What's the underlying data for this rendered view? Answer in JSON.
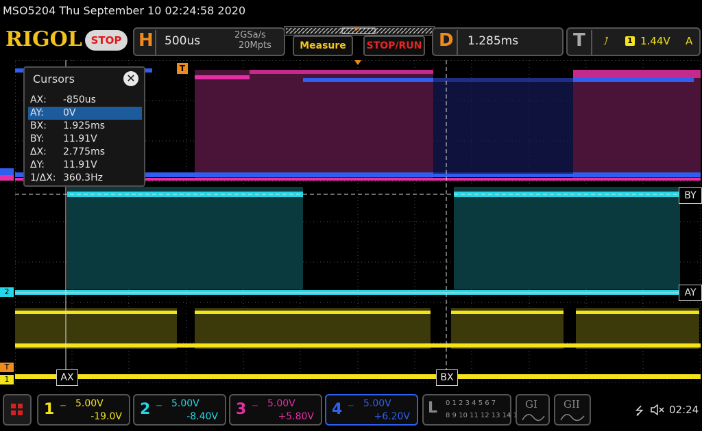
{
  "title": "MSO5204  Thu September 10 02:24:58 2020",
  "brand": "RIGOL",
  "run_state": "STOP",
  "horizontal": {
    "letter": "H",
    "timebase": "500us",
    "sample_rate": "2GSa/s",
    "memory_depth": "20Mpts"
  },
  "buttons": {
    "measure": "Measure",
    "stop_run": "STOP/RUN"
  },
  "delay": {
    "letter": "D",
    "value": "1.285ms"
  },
  "trigger": {
    "letter": "T",
    "source": "1",
    "level": "1.44V",
    "mode": "A"
  },
  "cursors": {
    "title": "Cursors",
    "close": "✕",
    "rows": [
      {
        "key": "AX:",
        "value": "-850us"
      },
      {
        "key": "AY:",
        "value": "0V"
      },
      {
        "key": "BX:",
        "value": "1.925ms"
      },
      {
        "key": "BY:",
        "value": "11.91V"
      },
      {
        "key": "ΔX:",
        "value": "2.775ms"
      },
      {
        "key": "ΔY:",
        "value": "11.91V"
      },
      {
        "key": "1/ΔX:",
        "value": "360.3Hz"
      }
    ],
    "selected_index": 1
  },
  "cursor_tags": {
    "ax": "AX",
    "bx": "BX",
    "ay": "AY",
    "by": "BY"
  },
  "edge_markers": {
    "ch1": "1",
    "ch2": "2",
    "trig": "T"
  },
  "channels": [
    {
      "num": "1",
      "scale": "5.00V",
      "offset": "-19.0V",
      "color": "#f5e31a"
    },
    {
      "num": "2",
      "scale": "5.00V",
      "offset": "-8.40V",
      "color": "#23d7e6"
    },
    {
      "num": "3",
      "scale": "5.00V",
      "offset": "+5.80V",
      "color": "#e62fa4"
    },
    {
      "num": "4",
      "scale": "5.00V",
      "offset": "+6.20V",
      "color": "#2f5ff0"
    }
  ],
  "logic": {
    "letter": "L",
    "row1": "0 1 2 3   4 5 6 7",
    "row2": "8 9 10 11  12 13 14 15"
  },
  "decoders": [
    {
      "label": "GI"
    },
    {
      "label": "GII"
    }
  ],
  "status": {
    "time": "02:24"
  },
  "colors": {
    "accent": "#f08a1c",
    "trigger_yellow": "#f5c51b",
    "stop_red": "#e82424"
  }
}
